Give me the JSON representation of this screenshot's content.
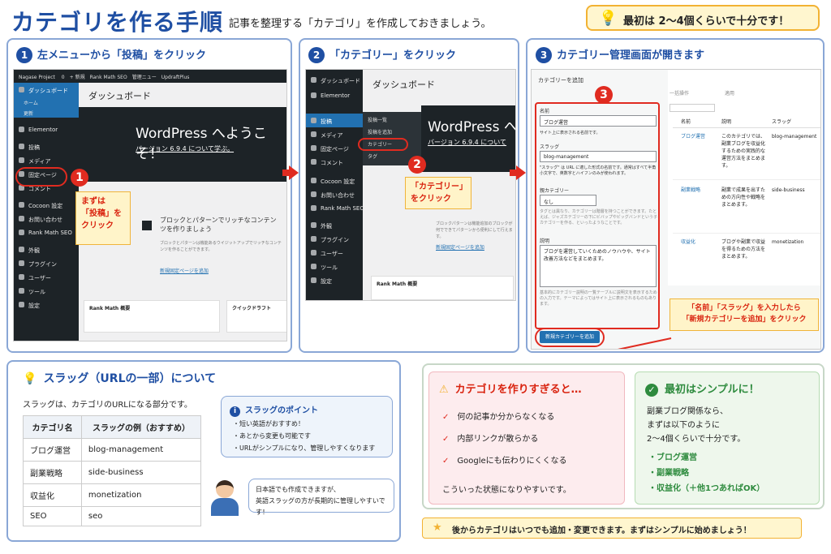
{
  "header": {
    "title": "カテゴリを作る手順",
    "subtitle": "記事を整理する「カテゴリ」を作成しておきましょう。",
    "tip": "最初は 2〜4個くらいで十分です！"
  },
  "step1": {
    "num": "1",
    "title": "左メニューから「投稿」をクリック",
    "adminbar": "Nagase Project　 0　+ 新規　Rank Math SEO　管理ニュー　UpdraftPlus",
    "menu": [
      "ダッシュボード",
      "ホーム",
      "更新",
      "Elementor",
      "投稿",
      "メディア",
      "固定ページ",
      "コメント",
      "Cocoon 設定",
      "お問い合わせ",
      "Rank Math SEO",
      "外観",
      "プラグイン",
      "ユーザー",
      "ツール",
      "設定"
    ],
    "dash": "ダッシュボード",
    "welcome": "WordPress へようこそ！",
    "version": "バージョン 6.9.4 について学ぶ。",
    "block_title": "ブロックとパターンでリッチなコンテンツを作りましょう",
    "block_desc": "ブロックとパターンは機能あるウイジットアップでリッチなコンテンツを作ることができます。",
    "block_link": "新規固定ページを追加",
    "widget1": "Rank Math 概要",
    "widget2": "クイックドラフト",
    "marker": "1",
    "callout": [
      "まずは",
      "「投稿」を",
      "クリック"
    ]
  },
  "step2": {
    "num": "2",
    "title": "「カテゴリー」をクリック",
    "menu": [
      "ダッシュボード",
      "Elementor",
      "投稿",
      "メディア",
      "固定ページ",
      "コメント",
      "Cocoon 設定",
      "お問い合わせ",
      "Rank Math SEO",
      "外観",
      "プラグイン",
      "ユーザー",
      "ツール",
      "設定"
    ],
    "dash": "ダッシュボード",
    "welcome": "WordPress へ",
    "version": "バージョン 6.9.4 について",
    "flyout": [
      "投稿一覧",
      "投稿を追加",
      "カテゴリー",
      "タグ"
    ],
    "block_desc": "ブロックパターンは機能追加のブロックが何でできてパターンから便利にして行えます。",
    "block_link": "新規固定ページを追加",
    "widget1": "Rank Math 概要",
    "marker": "2",
    "callout": [
      "「カテゴリー」",
      "をクリック"
    ]
  },
  "step3": {
    "num": "3",
    "title": "カテゴリー管理画面が開きます",
    "add_title": "カテゴリーを追加",
    "name_label": "名前",
    "name_value": "ブログ運営",
    "name_help": "サイト上に表示される名前です。",
    "slug_label": "スラッグ",
    "slug_value": "blog-management",
    "slug_help": "\"スラッグ\" は URL に適した形式の名前です。通常はすべて半角小文字で、英数字とハイフンのみが使われます。",
    "parent_label": "親カテゴリー",
    "parent_value": "なし",
    "parent_help": "タグとは異なり、カテゴリーは階層を持つことができます。たとえば、ジャズカテゴリーの下にビバップやビッグバンドという子カテゴリーを作る、といったようなことです。",
    "desc_label": "説明",
    "desc_value": "ブログを運営していくためのノウハウや、サイト改善方法などをまとめます。",
    "desc_help": "基本的にカテゴリー説明の一覧テーブルに説明文を表示するための入力です。テーマによってはサイト上に表示されるものもあります。",
    "add_button": "新規カテゴリーを追加",
    "bulk": "一括操作",
    "bulk_btn": "適用",
    "cols": [
      "名前",
      "説明",
      "スラッグ"
    ],
    "rows": [
      {
        "name": "ブログ運営",
        "desc": "このカテゴリでは、副業ブログを収益化するための実践的な運営方法をまとめます。",
        "slug": "blog-management"
      },
      {
        "name": "副業戦略",
        "desc": "副業で成果を出すための方向性や戦略をまとめます。",
        "slug": "side-business"
      },
      {
        "name": "収益化",
        "desc": "ブログや副業で収益を得るための方法をまとめます。",
        "slug": "monetization"
      }
    ],
    "marker": "3",
    "callout": [
      "「名前」「スラッグ」を入力したら",
      "「新規カテゴリーを追加」をクリック"
    ]
  },
  "slug": {
    "title": "スラッグ（URLの一部）について",
    "lead": "スラッグは、カテゴリのURLになる部分です。",
    "cols": [
      "カテゴリ名",
      "スラッグの例（おすすめ）"
    ],
    "rows": [
      [
        "ブログ運営",
        "blog-management"
      ],
      [
        "副業戦略",
        "side-business"
      ],
      [
        "収益化",
        "monetization"
      ],
      [
        "SEO",
        "seo"
      ]
    ],
    "point_title": "スラッグのポイント",
    "points": [
      "短い英語がおすすめ！",
      "あとから変更も可能です",
      "URLがシンプルになり、管理しやすくなります"
    ],
    "speech": [
      "日本語でも作成できますが、",
      "英語スラッグの方が長期的に管理しやすいです！"
    ]
  },
  "warn": {
    "title": "カテゴリを作りすぎると…",
    "items": [
      "何の記事か分からなくなる",
      "内部リンクが散らかる",
      "Googleにも伝わりにくくなる"
    ],
    "foot": "こういった状態になりやすいです。"
  },
  "simple": {
    "title": "最初はシンプルに！",
    "lead": [
      "副業ブログ関係なら、",
      "まずは以下のように",
      "2〜4個くらいで十分です。"
    ],
    "items": [
      "ブログ運営",
      "副業戦略",
      "収益化（＋他1つあればOK）"
    ]
  },
  "footer": "後からカテゴリはいつでも追加・変更できます。まずはシンプルに始めましょう！",
  "colors": {
    "blue": "#1f4fa3",
    "red": "#e02b20",
    "green": "#2e8b3e",
    "yellow": "#f2b233"
  }
}
